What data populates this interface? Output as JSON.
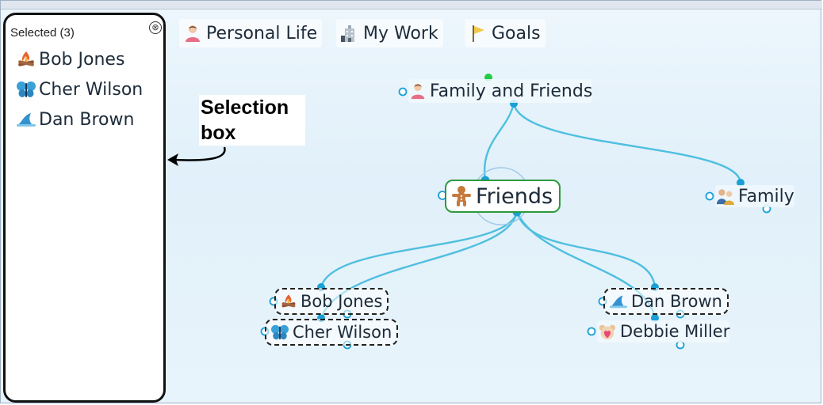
{
  "selected_pane": {
    "title": "Selected (3)",
    "close_glyph": "⊗",
    "items": [
      {
        "label": "Bob Jones",
        "icon": "campfire-icon"
      },
      {
        "label": "Cher Wilson",
        "icon": "butterfly-icon"
      },
      {
        "label": "Dan Brown",
        "icon": "shark-fin-icon"
      }
    ]
  },
  "tabs": [
    {
      "label": "Personal Life",
      "icon": "person-icon"
    },
    {
      "label": "My Work",
      "icon": "building-icon"
    },
    {
      "label": "Goals",
      "icon": "flag-icon"
    }
  ],
  "annotation": {
    "line1": "Selection",
    "line2": "box"
  },
  "map": {
    "root": {
      "label": "Family and Friends",
      "icon": "person-icon"
    },
    "active": {
      "label": "Friends",
      "icon": "gingerbread-icon"
    },
    "family": {
      "label": "Family",
      "icon": "family-icon"
    },
    "children": [
      {
        "label": "Bob Jones",
        "icon": "campfire-icon",
        "selected": true
      },
      {
        "label": "Cher Wilson",
        "icon": "butterfly-icon",
        "selected": true
      },
      {
        "label": "Dan Brown",
        "icon": "shark-fin-icon",
        "selected": true
      },
      {
        "label": "Debbie Miller",
        "icon": "heart-bear-icon",
        "selected": false
      }
    ]
  },
  "colors": {
    "link": "#4fbfdf",
    "connector": "#1aa0d6",
    "active_border": "#2e9a3e",
    "background": "#e4f1fa"
  }
}
